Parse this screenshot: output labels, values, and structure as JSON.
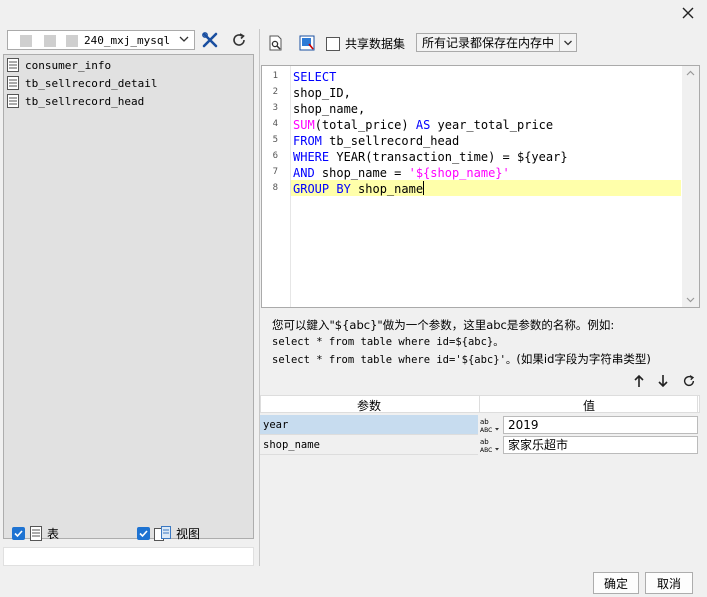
{
  "left": {
    "connection_label": "240_mxj_mysql",
    "tables": [
      "consumer_info",
      "tb_sellrecord_detail",
      "tb_sellrecord_head"
    ],
    "filter_table_label": "表",
    "filter_view_label": "视图"
  },
  "right": {
    "share_label": "共享数据集",
    "memory_option": "所有记录都保存在内存中",
    "sql_lines": [
      "SELECT",
      "shop_ID,",
      "shop_name,",
      "SUM(total_price) AS year_total_price",
      "FROM tb_sellrecord_head",
      "WHERE YEAR(transaction_time) = ${year}",
      "AND shop_name = '${shop_name}'",
      "GROUP BY shop_name"
    ],
    "line_numbers": [
      "1",
      "2",
      "3",
      "4",
      "5",
      "6",
      "7",
      "8"
    ],
    "hint_line1": "您可以鍵入\"${abc}\"做为一个参数，这里abc是参数的名称。例如:",
    "hint_line2": "select * from table where id=${abc}。",
    "hint_line3_code": "select * from table where id='${abc}'。",
    "hint_line3_text": "(如果id字段为字符串类型)",
    "param_header_name": "参数",
    "param_header_value": "值",
    "params": [
      {
        "name": "year",
        "value": "2019"
      },
      {
        "name": "shop_name",
        "value": "家家乐超市"
      }
    ],
    "type_icon_text": "ABC"
  },
  "buttons": {
    "ok": "确定",
    "cancel": "取消"
  }
}
